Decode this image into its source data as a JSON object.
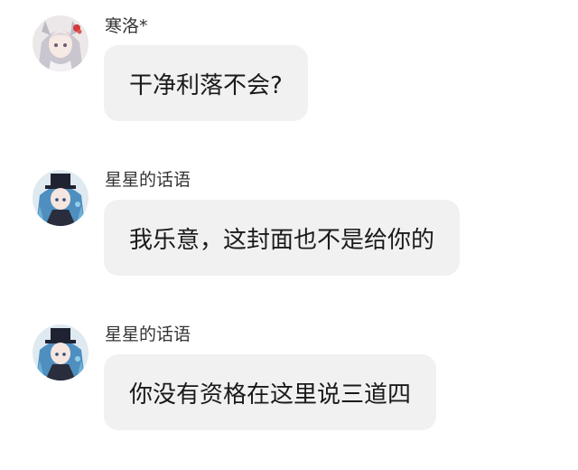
{
  "messages": [
    {
      "sender": "寒洛*",
      "text": "干净利落不会?",
      "avatar_icon": "anime-girl-white-hair-avatar-icon"
    },
    {
      "sender": "星星的话语",
      "text": "我乐意，这封面也不是给你的",
      "avatar_icon": "anime-girl-blue-hair-top-hat-avatar-icon"
    },
    {
      "sender": "星星的话语",
      "text": "你没有资格在这里说三道四",
      "avatar_icon": "anime-girl-blue-hair-top-hat-avatar-icon"
    }
  ],
  "colors": {
    "background": "#ffffff",
    "bubble": "#f1f1f1",
    "name_text": "#333333",
    "message_text": "#1a1a1a"
  }
}
